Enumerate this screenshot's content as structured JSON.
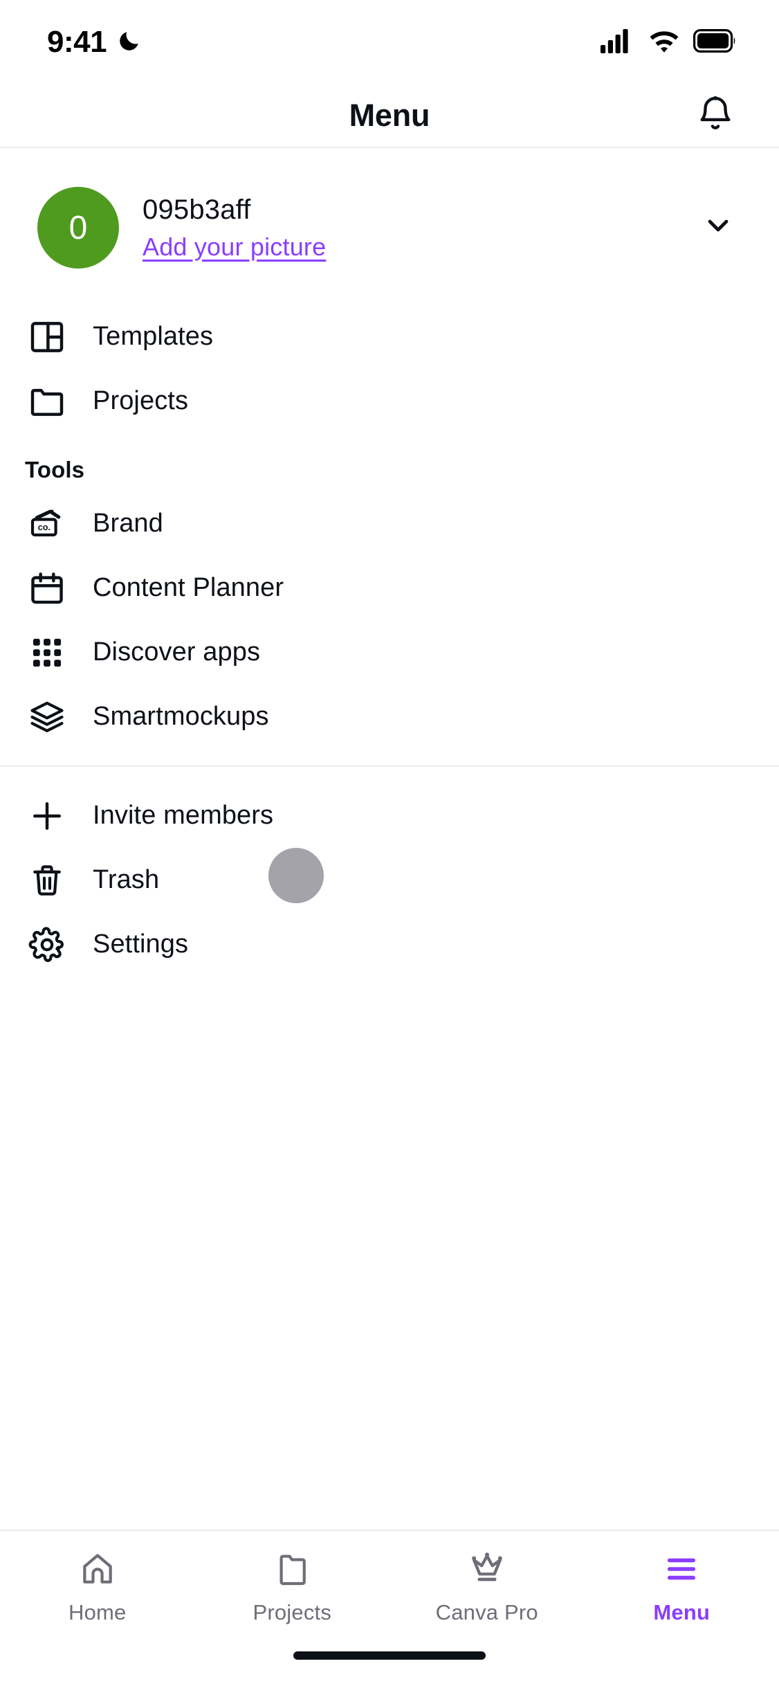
{
  "status_bar": {
    "time": "9:41",
    "dnd_icon": "crescent-moon-icon",
    "signal_icon": "cellular-signal-icon",
    "wifi_icon": "wifi-icon",
    "battery_icon": "battery-full-icon"
  },
  "header": {
    "title": "Menu",
    "notifications_icon": "bell-icon"
  },
  "profile": {
    "avatar_initial": "0",
    "avatar_color": "#4e9b1f",
    "username": "095b3aff",
    "add_picture_label": "Add your picture",
    "link_color": "#8b3dff",
    "expand_icon": "chevron-down-icon"
  },
  "sections": [
    {
      "title": "",
      "items": [
        {
          "label": "Templates",
          "icon": "templates-layout-icon"
        },
        {
          "label": "Projects",
          "icon": "folder-icon"
        }
      ]
    },
    {
      "title": "Tools",
      "items": [
        {
          "label": "Brand",
          "icon": "brand-card-icon"
        },
        {
          "label": "Content Planner",
          "icon": "calendar-icon"
        },
        {
          "label": "Discover apps",
          "icon": "apps-grid-icon"
        },
        {
          "label": "Smartmockups",
          "icon": "layers-stack-icon"
        }
      ]
    },
    {
      "title": "",
      "items": [
        {
          "label": "Invite members",
          "icon": "plus-icon"
        },
        {
          "label": "Trash",
          "icon": "trash-icon"
        },
        {
          "label": "Settings",
          "icon": "gear-icon"
        }
      ]
    }
  ],
  "tabbar": {
    "active_color": "#8b3dff",
    "inactive_color": "#6e6e78",
    "tabs": [
      {
        "label": "Home",
        "icon": "home-icon",
        "active": false
      },
      {
        "label": "Projects",
        "icon": "folder-icon",
        "active": false
      },
      {
        "label": "Canva Pro",
        "icon": "crown-icon",
        "active": false
      },
      {
        "label": "Menu",
        "icon": "hamburger-menu-icon",
        "active": true
      }
    ]
  },
  "overlay": {
    "touch_indicator": "touch-point-indicator"
  }
}
